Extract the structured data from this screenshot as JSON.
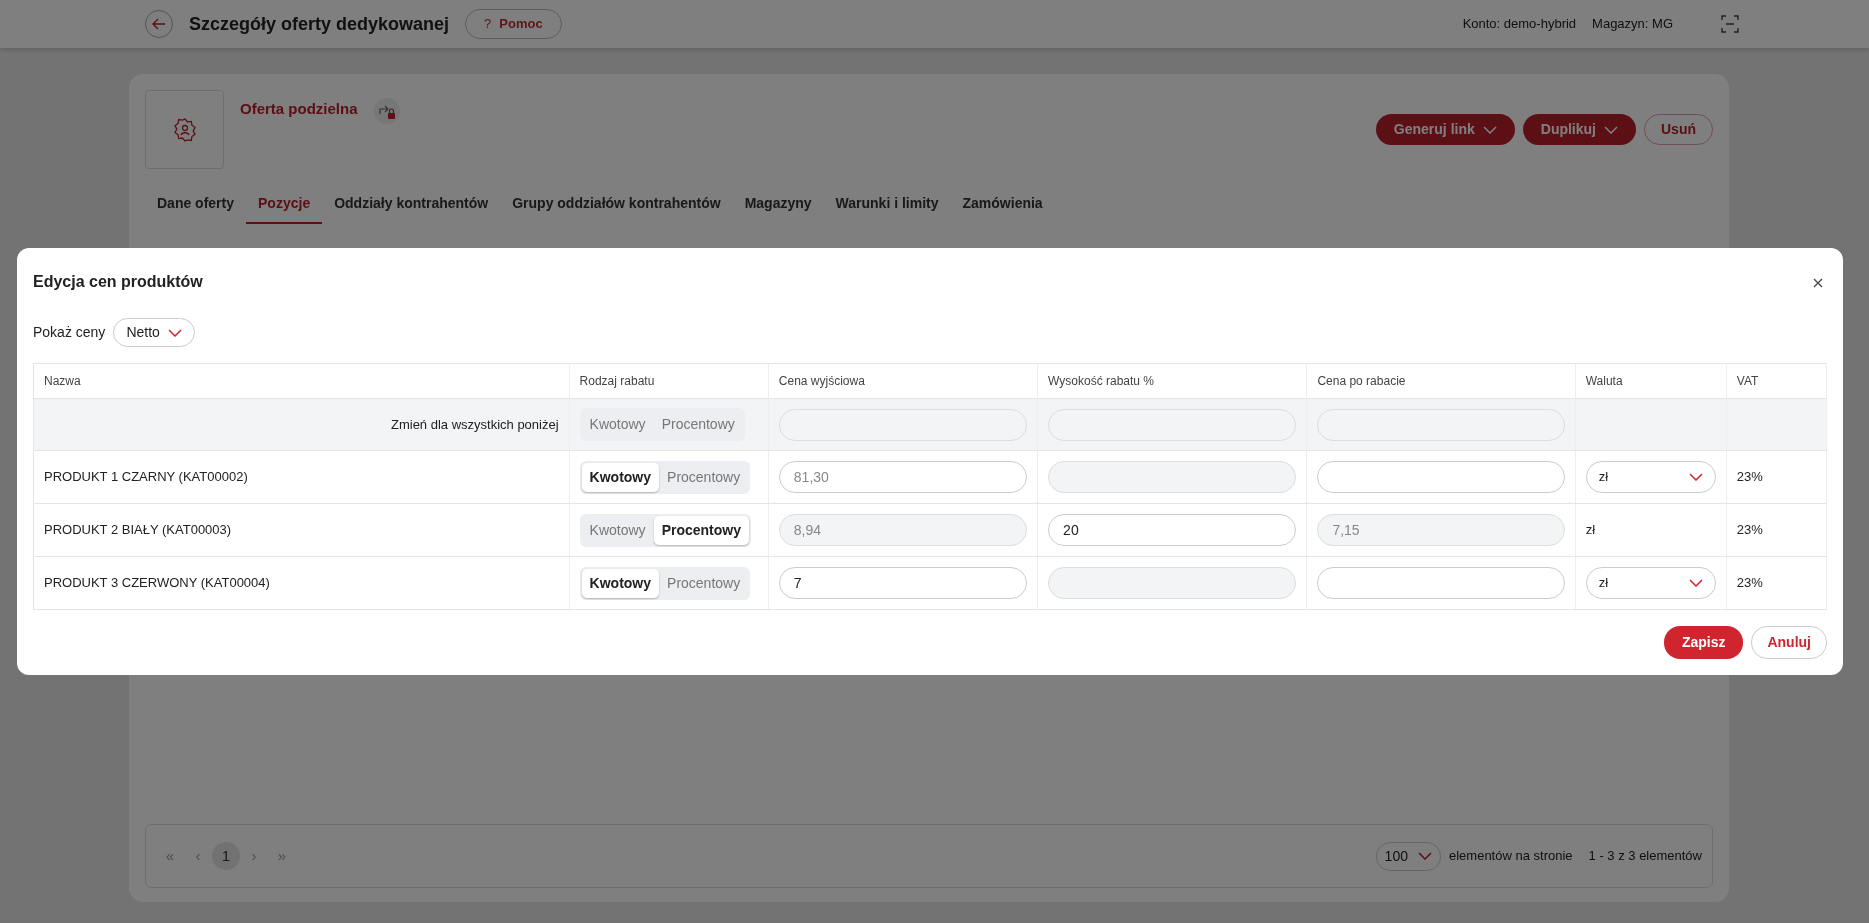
{
  "header": {
    "title": "Szczegóły oferty dedykowanej",
    "help_glyph": "?",
    "help_label": "Pomoc",
    "account_label": "Konto:",
    "account_value": "demo-hybrid",
    "warehouse_label": "Magazyn:",
    "warehouse_value": "MG"
  },
  "card": {
    "title": "Oferta podzielna",
    "actions": [
      {
        "label": "Generuj link",
        "kind": "dropdown"
      },
      {
        "label": "Duplikuj",
        "kind": "dropdown"
      },
      {
        "label": "Usuń",
        "kind": "outline"
      }
    ],
    "tabs": [
      {
        "label": "Dane oferty",
        "selected": false
      },
      {
        "label": "Pozycje",
        "selected": true
      },
      {
        "label": "Oddziały kontrahentów",
        "selected": false
      },
      {
        "label": "Grupy oddziałów kontrahentów",
        "selected": false
      },
      {
        "label": "Magazyny",
        "selected": false
      },
      {
        "label": "Warunki i limity",
        "selected": false
      },
      {
        "label": "Zamówienia",
        "selected": false
      }
    ]
  },
  "pagination": {
    "first": "«",
    "prev": "‹",
    "pages": [
      {
        "label": "1",
        "selected": true
      }
    ],
    "next": "›",
    "last": "»",
    "page_size": "100",
    "page_size_label": "elementów na stronie",
    "range": "1 - 3 z 3 elementów"
  },
  "modal": {
    "title": "Edycja cen produktów",
    "price_label": "Pokaż ceny",
    "price_mode": "Netto",
    "columns": [
      "Nazwa",
      "Rodzaj rabatu",
      "Cena wyjściowa",
      "Wysokość rabatu %",
      "Cena po rabacie",
      "Waluta",
      "VAT"
    ],
    "bulk_row": {
      "label": "Zmień dla wszystkich poniżej",
      "discount_options": [
        {
          "label": "Kwotowy",
          "selected": false
        },
        {
          "label": "Procentowy",
          "selected": false
        }
      ]
    },
    "rows": [
      {
        "name": "PRODUKT 1 CZARNY (KAT00002)",
        "discount_options": [
          {
            "label": "Kwotowy",
            "selected": true
          },
          {
            "label": "Procentowy",
            "selected": false
          }
        ],
        "base_price": {
          "placeholder": "81,30",
          "disabled": false
        },
        "discount_pct": {
          "disabled": true
        },
        "final_price": {
          "disabled": false
        },
        "currency": {
          "kind": "select",
          "value": "zł"
        },
        "vat": "23%"
      },
      {
        "name": "PRODUKT 2 BIAŁY (KAT00003)",
        "discount_options": [
          {
            "label": "Kwotowy",
            "selected": false
          },
          {
            "label": "Procentowy",
            "selected": true
          }
        ],
        "base_price": {
          "value": "8,94",
          "disabled": true
        },
        "discount_pct": {
          "value": "20",
          "disabled": false
        },
        "final_price": {
          "value": "7,15",
          "disabled": true
        },
        "currency": {
          "kind": "text",
          "value": "zł"
        },
        "vat": "23%"
      },
      {
        "name": "PRODUKT 3 CZERWONY (KAT00004)",
        "discount_options": [
          {
            "label": "Kwotowy",
            "selected": true
          },
          {
            "label": "Procentowy",
            "selected": false
          }
        ],
        "base_price": {
          "value": "7",
          "disabled": false
        },
        "discount_pct": {
          "disabled": true
        },
        "final_price": {
          "disabled": false
        },
        "currency": {
          "kind": "select",
          "value": "zł"
        },
        "vat": "23%"
      }
    ],
    "buttons": [
      {
        "label": "Zapisz",
        "kind": "primary"
      },
      {
        "label": "Anuluj",
        "kind": "outline"
      }
    ]
  }
}
